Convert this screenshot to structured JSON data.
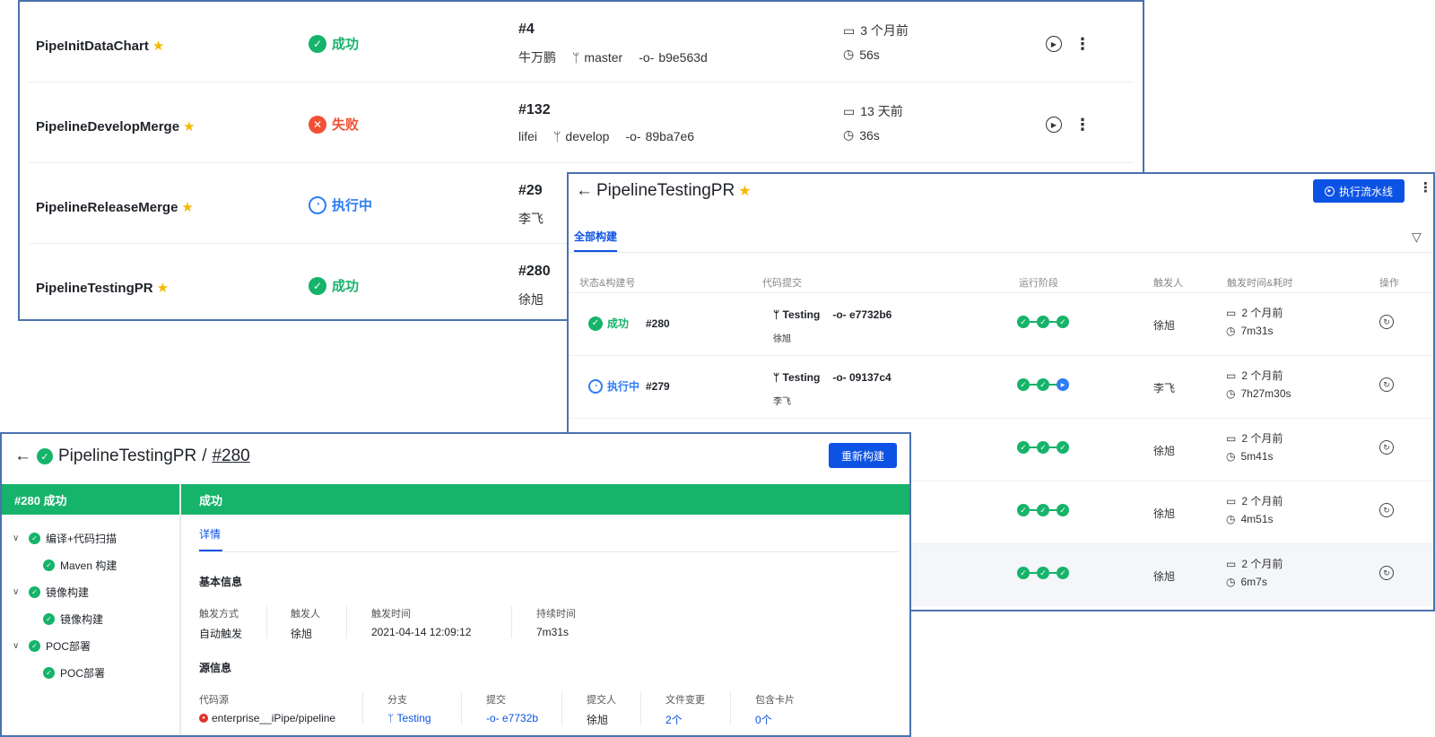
{
  "colors": {
    "success": "#16b36a",
    "failure": "#f05134",
    "running": "#2f7cf6",
    "primary": "#0c52e4",
    "star": "#f5b800"
  },
  "pipelines": [
    {
      "name": "PipeInitDataChart",
      "status": "成功",
      "status_kind": "success",
      "build": "#4",
      "author": "牛万鹏",
      "branch": "master",
      "commit": "b9e563d",
      "date": "3 个月前",
      "duration": "56s"
    },
    {
      "name": "PipelineDevelopMerge",
      "status": "失败",
      "status_kind": "failure",
      "build": "#132",
      "author": "lifei",
      "branch": "develop",
      "commit": "89ba7e6",
      "date": "13 天前",
      "duration": "36s"
    },
    {
      "name": "PipelineReleaseMerge",
      "status": "执行中",
      "status_kind": "running",
      "build": "#29",
      "author": "李飞"
    },
    {
      "name": "PipelineTestingPR",
      "status": "成功",
      "status_kind": "success",
      "build": "#280",
      "author": "徐旭"
    }
  ],
  "builds_panel": {
    "title": "PipelineTestingPR",
    "run_button": "执行流水线",
    "tab": "全部构建",
    "columns": [
      "状态&构建号",
      "代码提交",
      "运行阶段",
      "触发人",
      "触发时间&耗时",
      "操作"
    ],
    "rows": [
      {
        "status": "成功",
        "kind": "success",
        "num": "#280",
        "branch": "Testing",
        "commit": "e7732b6",
        "author": "徐旭",
        "trigger": "徐旭",
        "date": "2 个月前",
        "duration": "7m31s"
      },
      {
        "status": "执行中",
        "kind": "running",
        "num": "#279",
        "branch": "Testing",
        "commit": "09137c4",
        "author": "李飞",
        "trigger": "李飞",
        "date": "2 个月前",
        "duration": "7h27m30s"
      },
      {
        "trigger": "徐旭",
        "date": "2 个月前",
        "duration": "5m41s"
      },
      {
        "trigger": "徐旭",
        "date": "2 个月前",
        "duration": "4m51s"
      },
      {
        "trigger": "徐旭",
        "date": "2 个月前",
        "duration": "6m7s"
      }
    ]
  },
  "detail": {
    "pipeline": "PipelineTestingPR",
    "sep": "/",
    "build": "#280",
    "rebuild_button": "重新构建",
    "left_bar": "#280 成功",
    "right_bar": "成功",
    "tree": [
      {
        "label": "编译+代码扫描",
        "child": "Maven 构建"
      },
      {
        "label": "镜像构建",
        "child": "镜像构建"
      },
      {
        "label": "POC部署",
        "child": "POC部署"
      }
    ],
    "tab": "详情",
    "basic_title": "基本信息",
    "basic": {
      "trigger_mode_label": "触发方式",
      "trigger_mode": "自动触发",
      "trigger_user_label": "触发人",
      "trigger_user": "徐旭",
      "trigger_time_label": "触发时间",
      "trigger_time": "2021-04-14 12:09:12",
      "duration_label": "持续时间",
      "duration": "7m31s"
    },
    "source_title": "源信息",
    "source": {
      "repo_label": "代码源",
      "repo": "enterprise__iPipe/pipeline",
      "branch_label": "分支",
      "branch": "Testing",
      "commit_label": "提交",
      "commit": "e7732b",
      "committer_label": "提交人",
      "committer": "徐旭",
      "files_label": "文件变更",
      "files": "2个",
      "cards_label": "包含卡片",
      "cards": "0个"
    }
  }
}
